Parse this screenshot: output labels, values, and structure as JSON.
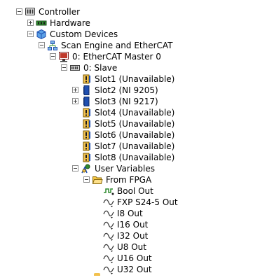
{
  "tree": {
    "controller": {
      "label": "Controller",
      "icon": "controller-icon",
      "expanded": true
    },
    "hardware": {
      "label": "Hardware",
      "icon": "hardware-icon",
      "expanded": false
    },
    "custom_devices": {
      "label": "Custom Devices",
      "icon": "custom-devices-icon",
      "expanded": true
    },
    "scan_engine": {
      "label": "Scan Engine and EtherCAT",
      "icon": "network-icon",
      "expanded": true
    },
    "ethercat_master": {
      "label": "0: EtherCAT Master 0",
      "icon": "ethercat-master-icon",
      "expanded": true
    },
    "slave": {
      "label": "0: Slave",
      "icon": "slave-chassis-icon",
      "expanded": true
    },
    "slots": [
      {
        "label": "Slot1 (Unavailable)",
        "icon": "unavailable-slot-icon",
        "expandable": false
      },
      {
        "label": "Slot2 (NI 9205)",
        "icon": "module-icon",
        "expandable": true
      },
      {
        "label": "Slot3 (NI 9217)",
        "icon": "module-icon",
        "expandable": true
      },
      {
        "label": "Slot4 (Unavailable)",
        "icon": "unavailable-slot-icon",
        "expandable": false
      },
      {
        "label": "Slot5 (Unavailable)",
        "icon": "unavailable-slot-icon",
        "expandable": false
      },
      {
        "label": "Slot6 (Unavailable)",
        "icon": "unavailable-slot-icon",
        "expandable": false
      },
      {
        "label": "Slot7 (Unavailable)",
        "icon": "unavailable-slot-icon",
        "expandable": false
      },
      {
        "label": "Slot8 (Unavailable)",
        "icon": "unavailable-slot-icon",
        "expandable": false
      }
    ],
    "user_variables": {
      "label": "User Variables",
      "icon": "user-variables-icon",
      "expanded": true
    },
    "from_fpga": {
      "label": "From FPGA",
      "icon": "folder-open-icon",
      "expanded": true
    },
    "variables": [
      {
        "label": "Bool Out",
        "icon": "bool-variable-icon"
      },
      {
        "label": "FXP S24-5 Out",
        "icon": "numeric-variable-icon"
      },
      {
        "label": "I8 Out",
        "icon": "numeric-variable-icon"
      },
      {
        "label": "I16 Out",
        "icon": "numeric-variable-icon"
      },
      {
        "label": "I32 Out",
        "icon": "numeric-variable-icon"
      },
      {
        "label": "U8 Out",
        "icon": "numeric-variable-icon"
      },
      {
        "label": "U16 Out",
        "icon": "numeric-variable-icon"
      },
      {
        "label": "U32 Out",
        "icon": "numeric-variable-icon"
      }
    ]
  },
  "colors": {
    "toggle_border": "#8c8c8c",
    "module_blue": "#1f4fb0",
    "warning_yellow": "#f2c14e",
    "folder_yellow": "#f4c542",
    "hardware_green": "#2e8b2e",
    "monitor_red": "#c0392b"
  }
}
